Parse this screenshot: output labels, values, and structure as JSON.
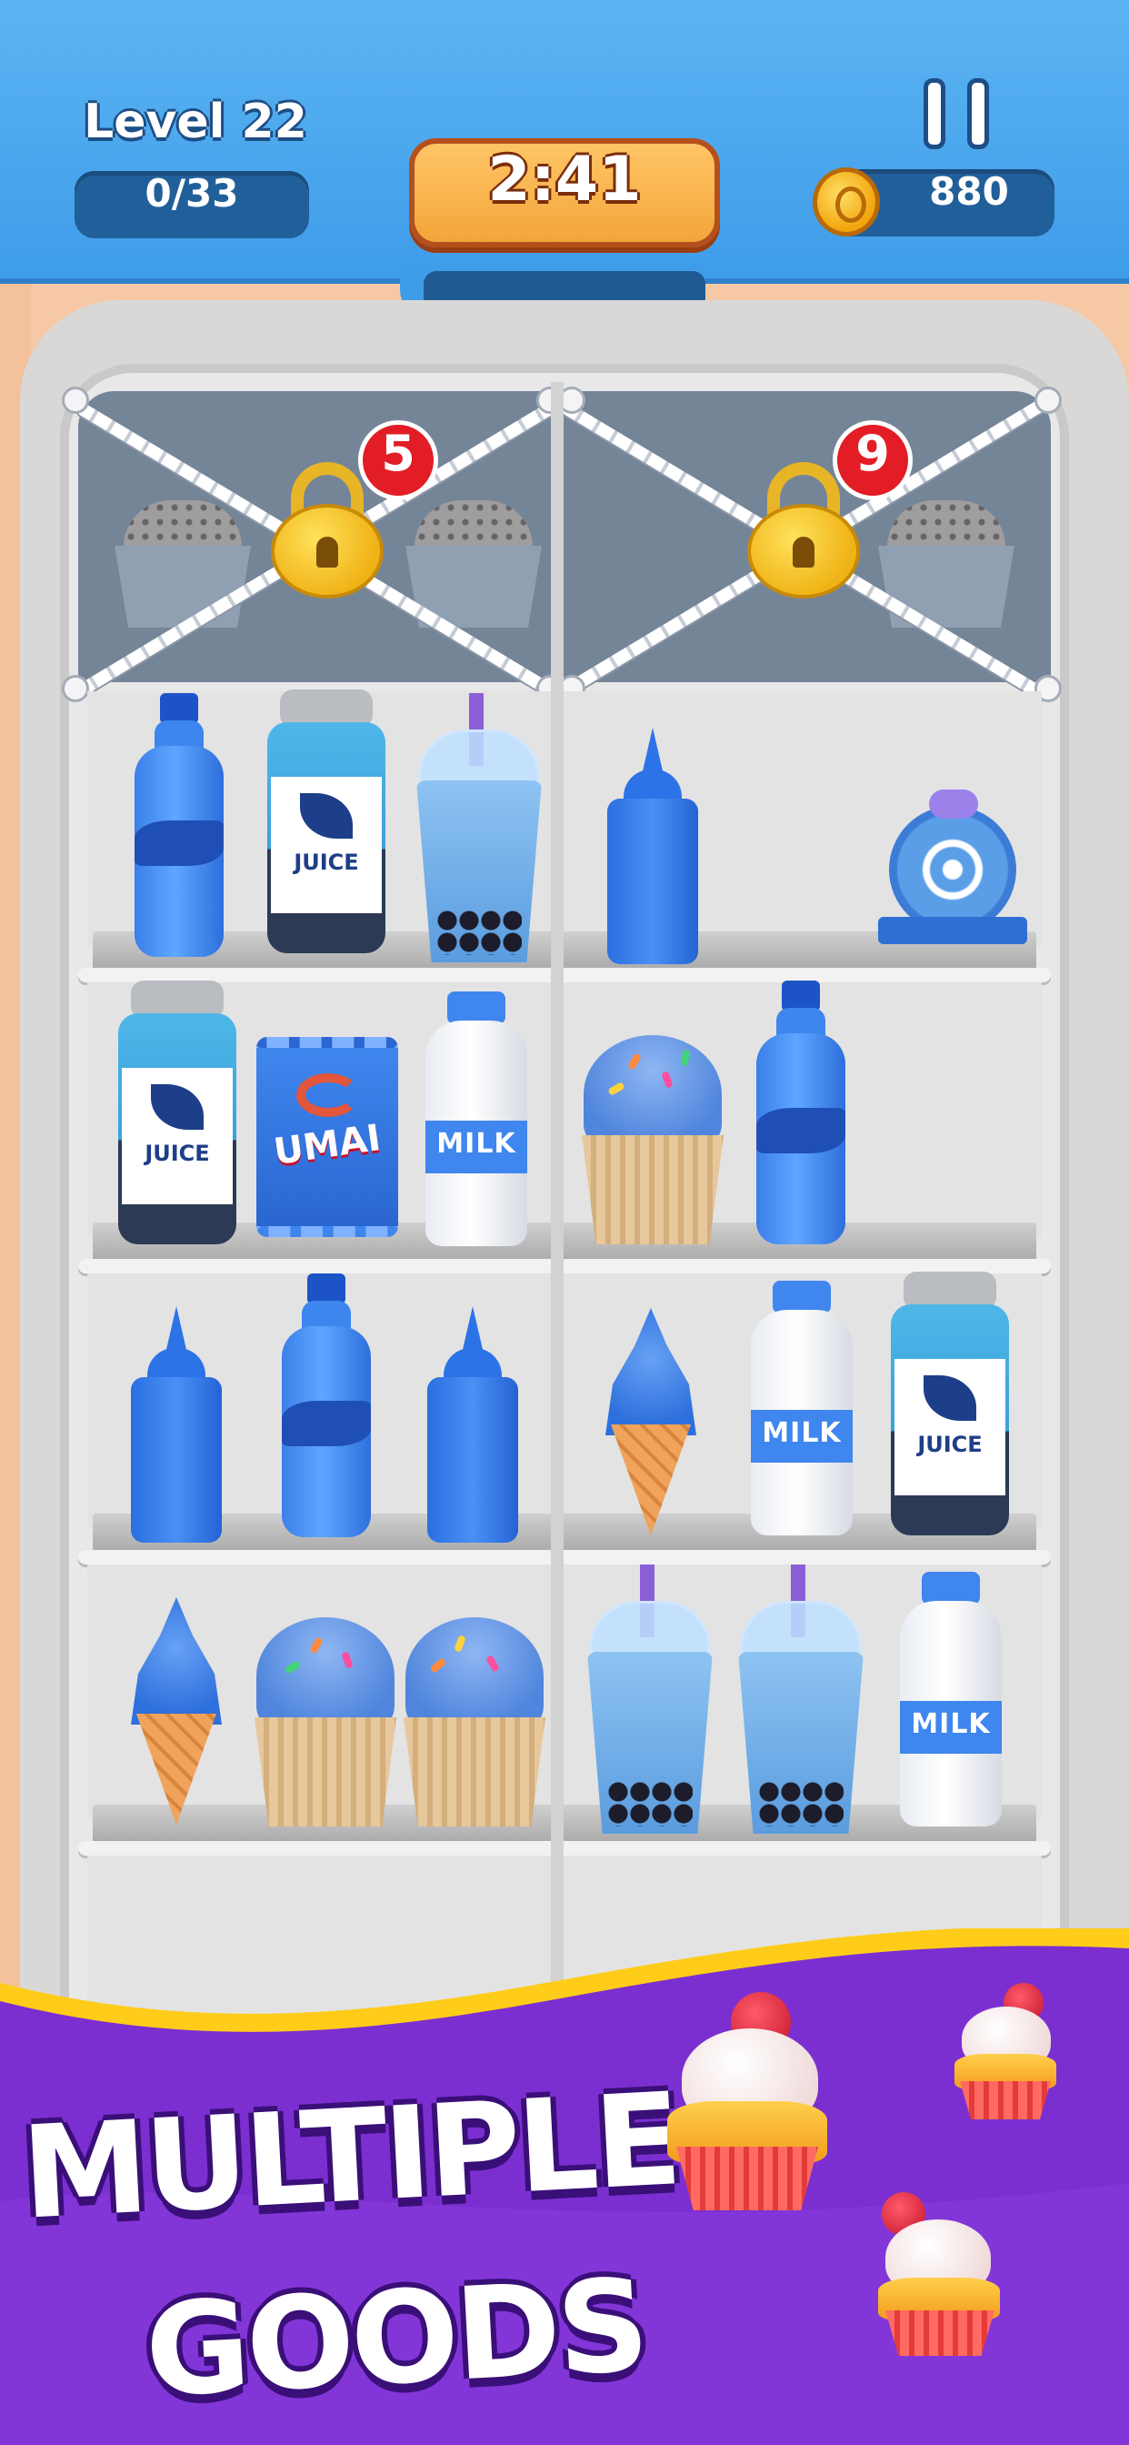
{
  "hud": {
    "level_label": "Level 22",
    "progress": "0/33",
    "timer": "2:41",
    "coins": "880",
    "pause_icon": "pause-icon",
    "coin_icon": "coin-icon"
  },
  "locks": [
    {
      "count": "5"
    },
    {
      "count": "9"
    }
  ],
  "labels": {
    "juice": "JUICE",
    "milk": "MILK",
    "chips": "UMAI"
  },
  "banner": {
    "line1": "MULTIPLE",
    "line2": "GOODS"
  },
  "colors": {
    "hud_blue": "#4aa8ee",
    "timer_orange": "#f7b04a",
    "banner_purple": "#7b2fd0",
    "banner_gold": "#ffcc1a",
    "lock_badge_red": "#e21d25"
  }
}
